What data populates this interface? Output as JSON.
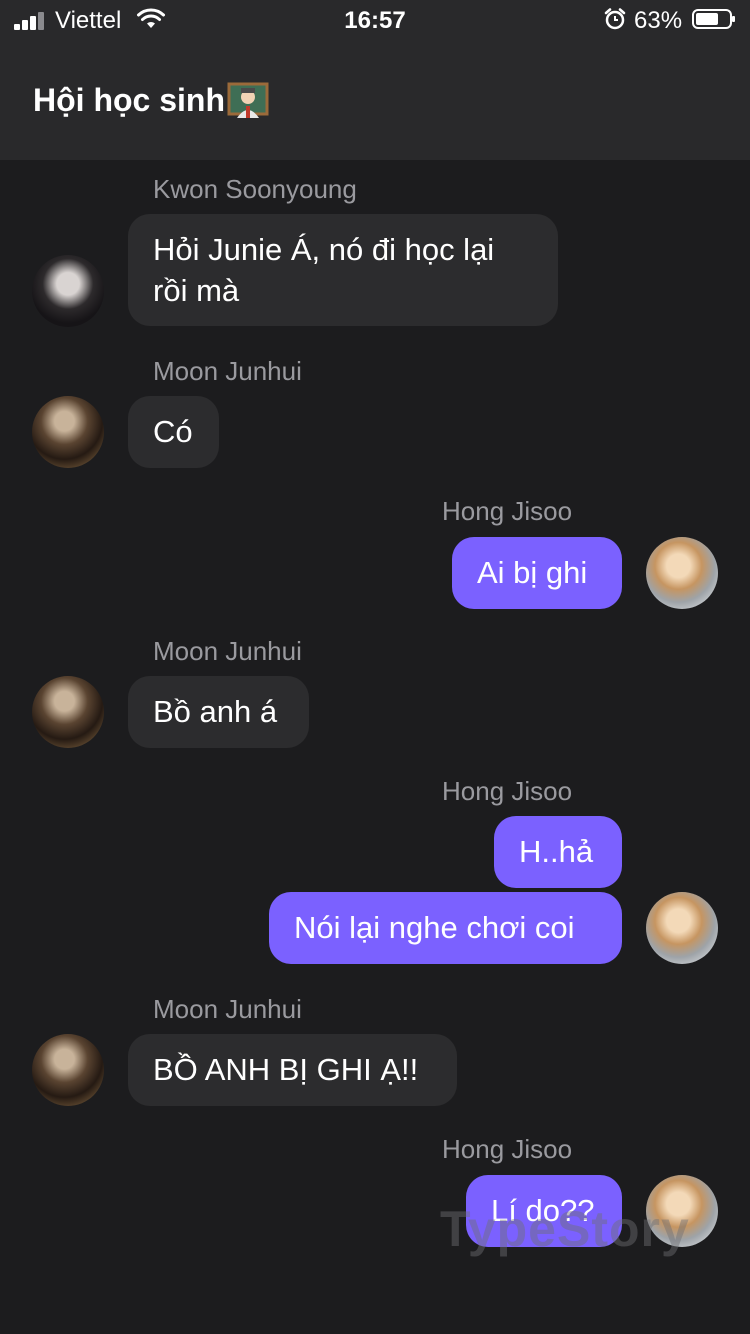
{
  "status_bar": {
    "carrier": "Viettel",
    "time": "16:57",
    "battery": "63%"
  },
  "header": {
    "title": "Hội học sinh"
  },
  "messages": [
    {
      "sender": "Kwon Soonyoung",
      "direction": "incoming",
      "text": "Hỏi Junie Á, nó đi học lại rồi mà"
    },
    {
      "sender": "Moon Junhui",
      "direction": "incoming",
      "text": "Có"
    },
    {
      "sender": "Hong Jisoo",
      "direction": "outgoing",
      "text": "Ai bị ghi"
    },
    {
      "sender": "Moon Junhui",
      "direction": "incoming",
      "text": "Bồ anh á"
    },
    {
      "sender": "Hong Jisoo",
      "direction": "outgoing",
      "text": "H..hả"
    },
    {
      "sender": "Hong Jisoo",
      "direction": "outgoing",
      "text": "Nói lại nghe chơi coi"
    },
    {
      "sender": "Moon Junhui",
      "direction": "incoming",
      "text": "BỒ ANH BỊ GHI Ạ!!"
    },
    {
      "sender": "Hong Jisoo",
      "direction": "outgoing",
      "text": "Lí do??"
    }
  ],
  "watermark": "TypeStory",
  "colors": {
    "background": "#1c1c1e",
    "header": "#29292b",
    "incoming_bubble": "#2c2c2e",
    "outgoing_bubble": "#7b61ff"
  }
}
